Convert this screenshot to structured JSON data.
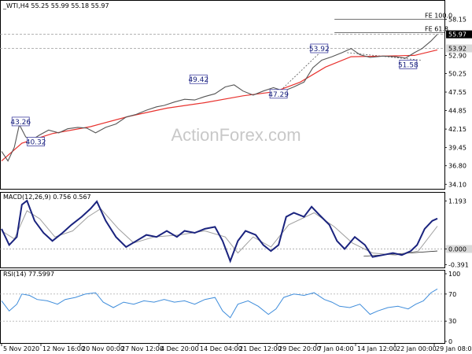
{
  "colors": {
    "price": "#555555",
    "ma": "#e8322e",
    "macd": "#1a237e",
    "signal": "#9e9e9e",
    "rsi": "#3f8ddb",
    "box_border": "#4040a0",
    "box_text": "#1a237e",
    "grid_dash": "#9a9a9a",
    "fe_line": "#444444",
    "current_price_bg": "#000000"
  },
  "chart_data": [
    {
      "type": "line",
      "panel": "price",
      "title": "_WTI,H4  55.25 55.99 55.18 55.97",
      "ylim": [
        33.9,
        59.6
      ],
      "yticks": [
        "58.15",
        "55.97",
        "53.92",
        "52.90",
        "50.25",
        "47.55",
        "44.85",
        "42.15",
        "39.45",
        "36.80",
        "34.10"
      ],
      "highlight_ticks": [
        "55.97",
        "53.92"
      ],
      "xlabels": [
        "5 Nov 2020",
        "12 Nov 16:00",
        "20 Nov 00:00",
        "27 Nov 12:00",
        "4 Dec 20:00",
        "14 Dec 04:00",
        "21 Dec 12:00",
        "29 Dec 20:00",
        "7 Jan 04:00",
        "14 Jan 12:00",
        "22 Jan 00:00",
        "29 Jan 08:00"
      ],
      "series": [
        {
          "name": "",
          "points": [
            [
              0,
              38.9
            ],
            [
              5,
              37.5
            ],
            [
              10,
              39.5
            ],
            [
              14,
              42.8
            ],
            [
              19,
              41.0
            ],
            [
              24,
              40.6
            ],
            [
              30,
              41.3
            ],
            [
              37,
              42.0
            ],
            [
              45,
              41.6
            ],
            [
              52,
              42.2
            ],
            [
              60,
              42.4
            ],
            [
              67,
              42.3
            ],
            [
              74,
              41.6
            ],
            [
              82,
              42.4
            ],
            [
              90,
              42.9
            ],
            [
              98,
              43.9
            ],
            [
              106,
              44.3
            ],
            [
              114,
              44.9
            ],
            [
              122,
              45.4
            ],
            [
              128,
              45.6
            ],
            [
              136,
              46.1
            ],
            [
              144,
              46.5
            ],
            [
              152,
              46.4
            ],
            [
              160,
              46.9
            ],
            [
              168,
              47.3
            ],
            [
              176,
              48.3
            ],
            [
              183,
              48.6
            ],
            [
              190,
              47.7
            ],
            [
              198,
              47.1
            ],
            [
              206,
              47.7
            ],
            [
              214,
              48.2
            ],
            [
              222,
              47.7
            ],
            [
              230,
              48.3
            ],
            [
              238,
              49.0
            ],
            [
              245,
              51.1
            ],
            [
              252,
              52.2
            ],
            [
              260,
              52.7
            ],
            [
              268,
              53.3
            ],
            [
              275,
              53.9
            ],
            [
              282,
              53.0
            ],
            [
              290,
              52.6
            ],
            [
              300,
              52.8
            ],
            [
              310,
              52.7
            ],
            [
              318,
              52.5
            ],
            [
              325,
              53.3
            ],
            [
              331,
              53.9
            ],
            [
              338,
              55.0
            ],
            [
              343,
              55.97
            ]
          ]
        },
        {
          "name": "",
          "points": [
            [
              0,
              37.5
            ],
            [
              16,
              40.1
            ],
            [
              40,
              41.5
            ],
            [
              70,
              42.5
            ],
            [
              100,
              44.0
            ],
            [
              130,
              45.2
            ],
            [
              160,
              46.0
            ],
            [
              190,
              47.0
            ],
            [
              215,
              47.6
            ],
            [
              235,
              49.0
            ],
            [
              255,
              51.2
            ],
            [
              275,
              52.7
            ],
            [
              300,
              52.8
            ],
            [
              325,
              52.9
            ],
            [
              343,
              53.7
            ]
          ]
        }
      ],
      "fe_levels": [
        {
          "label": "FE 100.0",
          "value": 58.15
        },
        {
          "label": "FE 61.8",
          "value": 56.2
        }
      ],
      "annotations": [
        {
          "text": "43.26",
          "x": 15,
          "y": 43.26
        },
        {
          "text": "40.32",
          "x": 27,
          "y": 40.32
        },
        {
          "text": "49.42",
          "x": 155,
          "y": 49.42
        },
        {
          "text": "47.29",
          "x": 218,
          "y": 47.29
        },
        {
          "text": "53.92",
          "x": 250,
          "y": 53.92
        },
        {
          "text": "51.58",
          "x": 320,
          "y": 51.58
        }
      ]
    },
    {
      "type": "line",
      "panel": "macd",
      "title": "MACD(12,26,9) 0.756 0.567",
      "ylim": [
        -0.42,
        1.3
      ],
      "yticks": [
        "1.193",
        "0.000",
        "-0.391"
      ],
      "highlight_ticks": [
        "0.000"
      ],
      "series": [
        {
          "name": "",
          "points": [
            [
              0,
              0.5
            ],
            [
              6,
              0.1
            ],
            [
              12,
              0.3
            ],
            [
              16,
              1.1
            ],
            [
              20,
              1.2
            ],
            [
              26,
              0.7
            ],
            [
              33,
              0.4
            ],
            [
              40,
              0.2
            ],
            [
              48,
              0.4
            ],
            [
              55,
              0.6
            ],
            [
              63,
              0.8
            ],
            [
              70,
              1.0
            ],
            [
              75,
              1.18
            ],
            [
              82,
              0.7
            ],
            [
              90,
              0.3
            ],
            [
              98,
              0.05
            ],
            [
              106,
              0.2
            ],
            [
              114,
              0.35
            ],
            [
              122,
              0.3
            ],
            [
              130,
              0.45
            ],
            [
              138,
              0.3
            ],
            [
              144,
              0.45
            ],
            [
              152,
              0.4
            ],
            [
              160,
              0.5
            ],
            [
              168,
              0.55
            ],
            [
              174,
              0.2
            ],
            [
              180,
              -0.3
            ],
            [
              186,
              0.2
            ],
            [
              192,
              0.45
            ],
            [
              200,
              0.35
            ],
            [
              206,
              0.1
            ],
            [
              212,
              -0.05
            ],
            [
              218,
              0.1
            ],
            [
              224,
              0.8
            ],
            [
              230,
              0.9
            ],
            [
              238,
              0.8
            ],
            [
              244,
              1.05
            ],
            [
              250,
              0.85
            ],
            [
              258,
              0.6
            ],
            [
              264,
              0.2
            ],
            [
              270,
              0.0
            ],
            [
              278,
              0.3
            ],
            [
              286,
              0.1
            ],
            [
              292,
              -0.2
            ],
            [
              300,
              -0.15
            ],
            [
              308,
              -0.1
            ],
            [
              315,
              -0.15
            ],
            [
              322,
              -0.05
            ],
            [
              327,
              0.1
            ],
            [
              333,
              0.5
            ],
            [
              339,
              0.7
            ],
            [
              343,
              0.756
            ]
          ]
        },
        {
          "name": "",
          "points": [
            [
              0,
              0.45
            ],
            [
              10,
              0.25
            ],
            [
              20,
              0.95
            ],
            [
              30,
              0.75
            ],
            [
              42,
              0.3
            ],
            [
              56,
              0.45
            ],
            [
              68,
              0.8
            ],
            [
              78,
              1.0
            ],
            [
              92,
              0.5
            ],
            [
              104,
              0.15
            ],
            [
              120,
              0.3
            ],
            [
              140,
              0.35
            ],
            [
              160,
              0.45
            ],
            [
              176,
              0.3
            ],
            [
              186,
              -0.1
            ],
            [
              198,
              0.3
            ],
            [
              212,
              0.05
            ],
            [
              226,
              0.6
            ],
            [
              246,
              0.9
            ],
            [
              262,
              0.55
            ],
            [
              276,
              0.15
            ],
            [
              292,
              -0.1
            ],
            [
              310,
              -0.15
            ],
            [
              328,
              -0.05
            ],
            [
              343,
              0.567
            ]
          ]
        }
      ]
    },
    {
      "type": "line",
      "panel": "rsi",
      "title": "RSI(14) 77.5997",
      "ylim": [
        0,
        100
      ],
      "yticks": [
        "100",
        "70",
        "30",
        "0"
      ],
      "series": [
        {
          "name": "",
          "points": [
            [
              0,
              60
            ],
            [
              6,
              45
            ],
            [
              12,
              55
            ],
            [
              16,
              70
            ],
            [
              22,
              68
            ],
            [
              28,
              62
            ],
            [
              36,
              60
            ],
            [
              44,
              55
            ],
            [
              50,
              62
            ],
            [
              58,
              65
            ],
            [
              66,
              70
            ],
            [
              74,
              72
            ],
            [
              80,
              58
            ],
            [
              88,
              50
            ],
            [
              96,
              58
            ],
            [
              104,
              55
            ],
            [
              112,
              60
            ],
            [
              120,
              58
            ],
            [
              128,
              62
            ],
            [
              136,
              58
            ],
            [
              144,
              60
            ],
            [
              152,
              55
            ],
            [
              160,
              62
            ],
            [
              168,
              65
            ],
            [
              174,
              45
            ],
            [
              180,
              35
            ],
            [
              186,
              55
            ],
            [
              194,
              60
            ],
            [
              202,
              52
            ],
            [
              210,
              40
            ],
            [
              216,
              48
            ],
            [
              222,
              65
            ],
            [
              230,
              70
            ],
            [
              238,
              68
            ],
            [
              246,
              72
            ],
            [
              254,
              62
            ],
            [
              260,
              58
            ],
            [
              266,
              52
            ],
            [
              274,
              50
            ],
            [
              282,
              55
            ],
            [
              290,
              40
            ],
            [
              296,
              45
            ],
            [
              304,
              50
            ],
            [
              312,
              52
            ],
            [
              320,
              48
            ],
            [
              326,
              55
            ],
            [
              332,
              60
            ],
            [
              338,
              72
            ],
            [
              343,
              77.6
            ]
          ]
        }
      ]
    }
  ],
  "watermark": "ActionForex.com",
  "current_price_label": "55.97"
}
